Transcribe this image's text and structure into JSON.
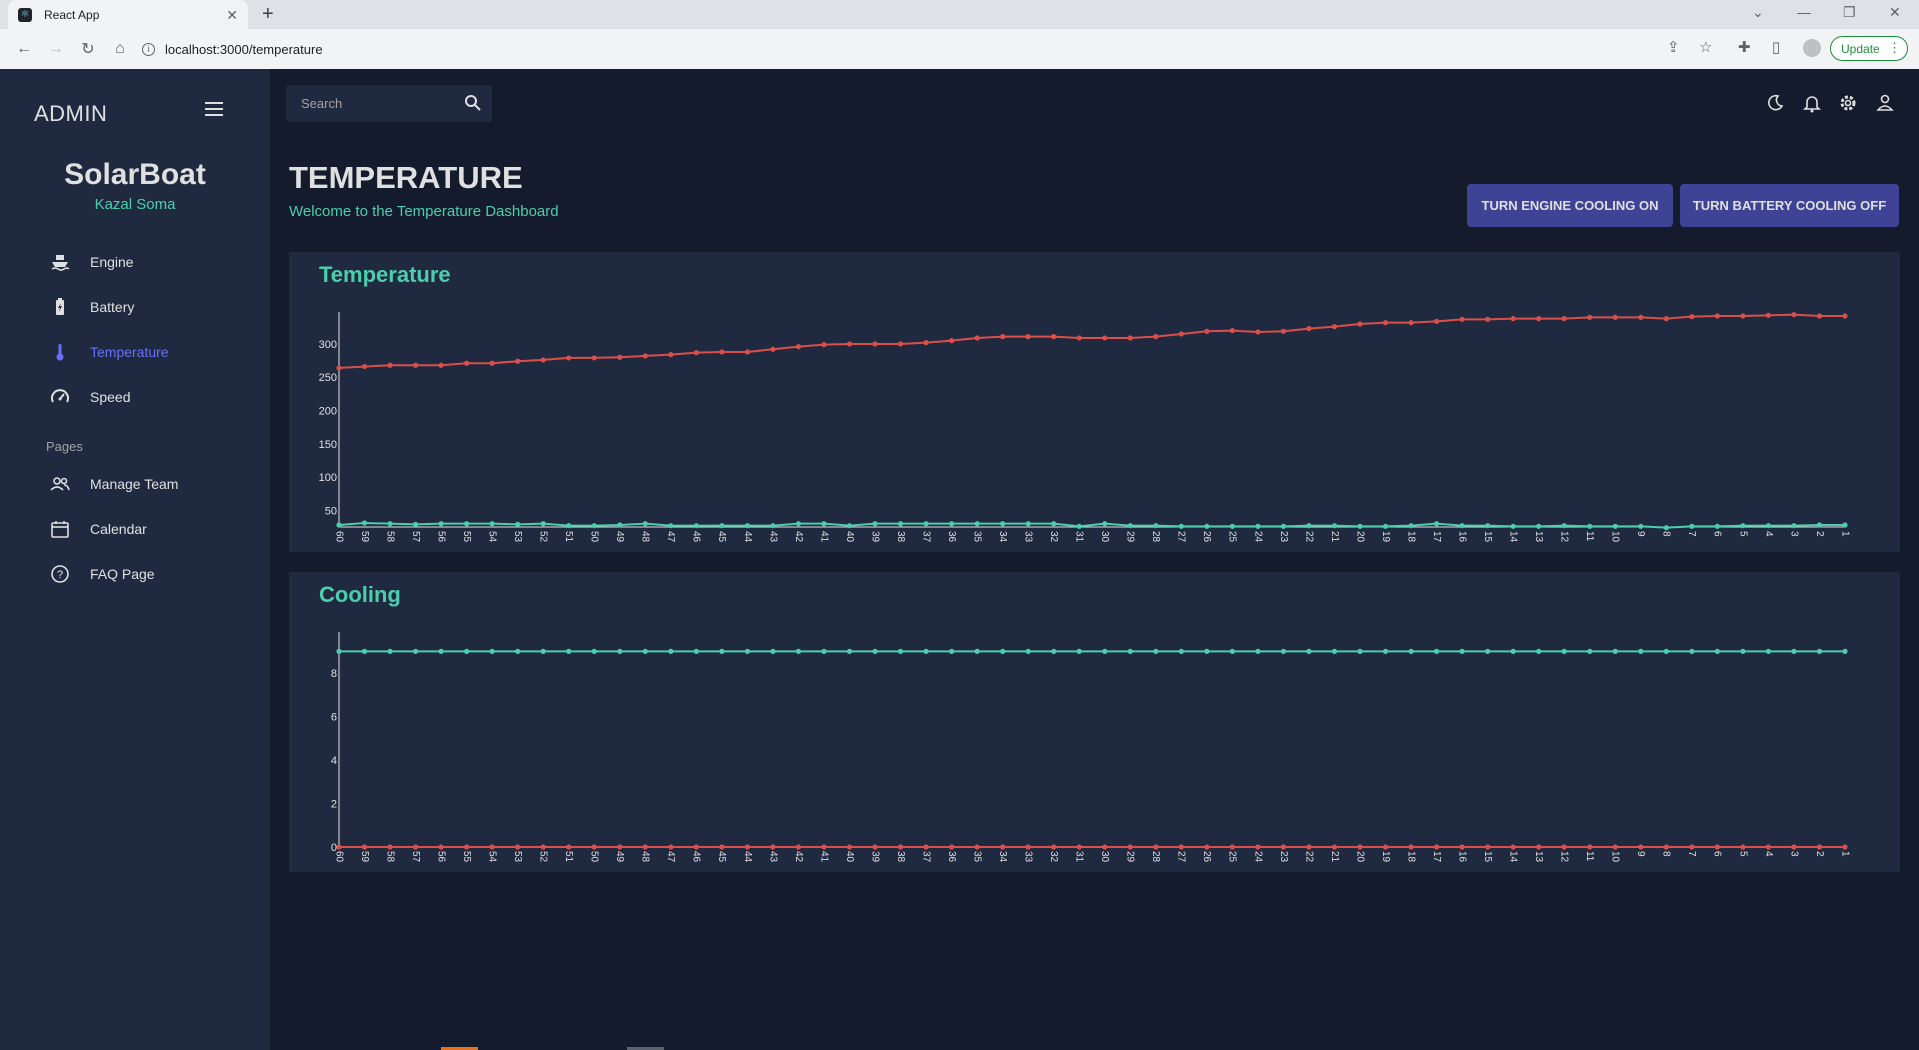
{
  "browser": {
    "tab_title": "React App",
    "url": "localhost:3000/temperature",
    "update_label": "Update"
  },
  "sidebar": {
    "brand": "ADMIN",
    "profile_name": "SolarBoat",
    "profile_role": "Kazal Soma",
    "items": [
      {
        "label": "Engine",
        "icon": "boat-icon"
      },
      {
        "label": "Battery",
        "icon": "battery-icon"
      },
      {
        "label": "Temperature",
        "icon": "thermometer-icon",
        "active": true
      },
      {
        "label": "Speed",
        "icon": "speedometer-icon"
      }
    ],
    "pages_label": "Pages",
    "page_items": [
      {
        "label": "Manage Team",
        "icon": "people-icon"
      },
      {
        "label": "Calendar",
        "icon": "calendar-icon"
      },
      {
        "label": "FAQ Page",
        "icon": "help-icon"
      }
    ]
  },
  "topbar": {
    "search_placeholder": "Search",
    "icons": [
      "dark-mode-icon",
      "notifications-icon",
      "settings-icon",
      "person-icon"
    ]
  },
  "header": {
    "title": "TEMPERATURE",
    "subtitle": "Welcome to the Temperature Dashboard"
  },
  "actions": {
    "engine_cooling": "TURN ENGINE COOLING ON",
    "battery_cooling": "TURN BATTERY COOLING OFF"
  },
  "colors": {
    "accent": "#4cceac",
    "button": "#3e4396",
    "series_red": "#db4f4a",
    "series_green": "#4cceac",
    "bg": "#141b2d",
    "panel": "#1f2a40"
  },
  "chart_data": [
    {
      "type": "line",
      "title": "Temperature",
      "categories": [
        "60",
        "59",
        "58",
        "57",
        "56",
        "55",
        "54",
        "53",
        "52",
        "51",
        "50",
        "49",
        "48",
        "47",
        "46",
        "45",
        "44",
        "43",
        "42",
        "41",
        "40",
        "39",
        "38",
        "37",
        "36",
        "35",
        "34",
        "33",
        "32",
        "31",
        "30",
        "29",
        "28",
        "27",
        "26",
        "25",
        "24",
        "23",
        "22",
        "21",
        "20",
        "19",
        "18",
        "17",
        "16",
        "15",
        "14",
        "13",
        "12",
        "11",
        "10",
        "9",
        "8",
        "7",
        "6",
        "5",
        "4",
        "3",
        "2",
        "1"
      ],
      "yticks": [
        50,
        100,
        150,
        200,
        250,
        300
      ],
      "ylim": [
        25,
        345
      ],
      "series": [
        {
          "color": "#db4f4a",
          "values": [
            264,
            266,
            268,
            268,
            268,
            271,
            271,
            274,
            276,
            279,
            279,
            280,
            282,
            284,
            287,
            288,
            288,
            292,
            296,
            299,
            300,
            300,
            300,
            302,
            305,
            309,
            311,
            311,
            311,
            309,
            309,
            309,
            311,
            315,
            319,
            320,
            318,
            319,
            323,
            326,
            330,
            332,
            332,
            334,
            337,
            337,
            338,
            338,
            338,
            340,
            340,
            340,
            338,
            341,
            342,
            342,
            343,
            344,
            342,
            342
          ]
        },
        {
          "color": "#4cceac",
          "values": [
            28,
            31,
            30,
            29,
            30,
            30,
            30,
            29,
            30,
            27,
            27,
            28,
            30,
            27,
            27,
            27,
            27,
            27,
            30,
            30,
            27,
            30,
            30,
            30,
            30,
            30,
            30,
            30,
            30,
            26,
            30,
            27,
            27,
            26,
            26,
            26,
            26,
            26,
            27,
            27,
            26,
            26,
            27,
            30,
            27,
            27,
            26,
            26,
            27,
            26,
            26,
            26,
            24,
            26,
            26,
            27,
            27,
            27,
            28,
            28
          ]
        }
      ]
    },
    {
      "type": "line",
      "title": "Cooling",
      "categories": [
        "60",
        "59",
        "58",
        "57",
        "56",
        "55",
        "54",
        "53",
        "52",
        "51",
        "50",
        "49",
        "48",
        "47",
        "46",
        "45",
        "44",
        "43",
        "42",
        "41",
        "40",
        "39",
        "38",
        "37",
        "36",
        "35",
        "34",
        "33",
        "32",
        "31",
        "30",
        "29",
        "28",
        "27",
        "26",
        "25",
        "24",
        "23",
        "22",
        "21",
        "20",
        "19",
        "18",
        "17",
        "16",
        "15",
        "14",
        "13",
        "12",
        "11",
        "10",
        "9",
        "8",
        "7",
        "6",
        "5",
        "4",
        "3",
        "2",
        "1"
      ],
      "yticks": [
        0,
        2,
        4,
        6,
        8
      ],
      "ylim": [
        0,
        9.8
      ],
      "series": [
        {
          "color": "#4cceac",
          "values": [
            9,
            9,
            9,
            9,
            9,
            9,
            9,
            9,
            9,
            9,
            9,
            9,
            9,
            9,
            9,
            9,
            9,
            9,
            9,
            9,
            9,
            9,
            9,
            9,
            9,
            9,
            9,
            9,
            9,
            9,
            9,
            9,
            9,
            9,
            9,
            9,
            9,
            9,
            9,
            9,
            9,
            9,
            9,
            9,
            9,
            9,
            9,
            9,
            9,
            9,
            9,
            9,
            9,
            9,
            9,
            9,
            9,
            9,
            9,
            9
          ]
        },
        {
          "color": "#db4f4a",
          "values": [
            0,
            0,
            0,
            0,
            0,
            0,
            0,
            0,
            0,
            0,
            0,
            0,
            0,
            0,
            0,
            0,
            0,
            0,
            0,
            0,
            0,
            0,
            0,
            0,
            0,
            0,
            0,
            0,
            0,
            0,
            0,
            0,
            0,
            0,
            0,
            0,
            0,
            0,
            0,
            0,
            0,
            0,
            0,
            0,
            0,
            0,
            0,
            0,
            0,
            0,
            0,
            0,
            0,
            0,
            0,
            0,
            0,
            0,
            0,
            0
          ]
        }
      ]
    }
  ]
}
